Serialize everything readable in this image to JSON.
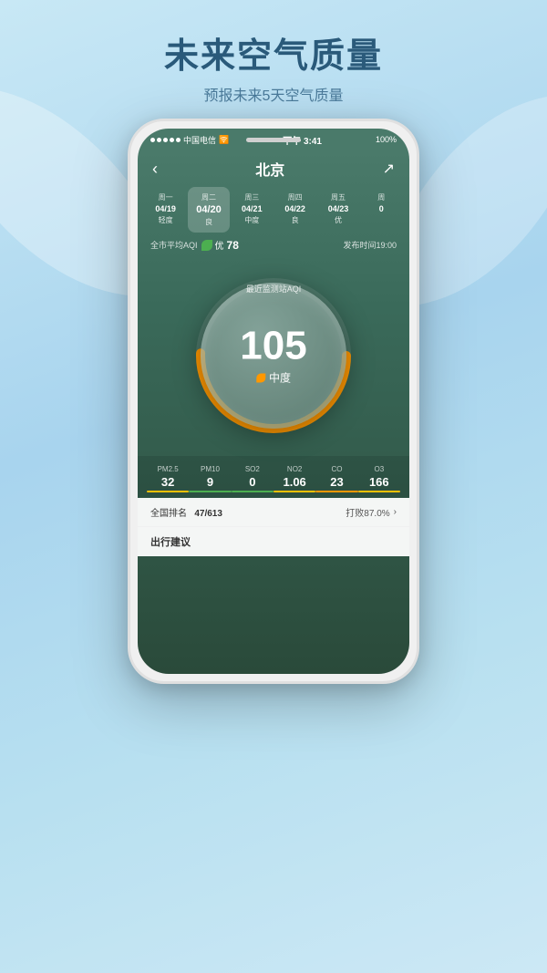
{
  "page": {
    "background": "light-blue-gradient"
  },
  "header": {
    "main_title": "未来空气质量",
    "sub_title": "预报未来5天空气质量"
  },
  "phone": {
    "status_bar": {
      "carrier": "中国电信",
      "wifi": true,
      "time": "下午 3:41",
      "battery": "100%"
    },
    "nav": {
      "back_label": "‹",
      "city": "北京",
      "share_label": "⬡"
    },
    "day_tabs": [
      {
        "weekday": "周一",
        "date": "04/19",
        "quality": "轻度",
        "active": false
      },
      {
        "weekday": "周二",
        "date": "04/20",
        "quality": "良",
        "active": true
      },
      {
        "weekday": "周三",
        "date": "04/21",
        "quality": "中度",
        "active": false
      },
      {
        "weekday": "周四",
        "date": "04/22",
        "quality": "良",
        "active": false
      },
      {
        "weekday": "周五",
        "date": "04/23",
        "quality": "优",
        "active": false
      },
      {
        "weekday": "周",
        "date": "0",
        "quality": "",
        "active": false
      }
    ],
    "aqi_info": {
      "label": "全市平均AQI",
      "value": "78",
      "quality": "优",
      "publish_time": "发布时间19:00"
    },
    "gauge": {
      "label": "最近监测站AQI",
      "value": "105",
      "quality": "中度"
    },
    "pollutants": [
      {
        "name": "PM2.5",
        "value": "32",
        "bar_color": "yellow"
      },
      {
        "name": "PM10",
        "value": "9",
        "bar_color": "green"
      },
      {
        "name": "SO2",
        "value": "0",
        "bar_color": "green"
      },
      {
        "name": "NO2",
        "value": "1.06",
        "bar_color": "yellow"
      },
      {
        "name": "CO",
        "value": "23",
        "bar_color": "orange"
      },
      {
        "name": "O3",
        "value": "166",
        "bar_color": "yellow"
      }
    ],
    "ranking": {
      "label": "全国排名",
      "rank": "47/613",
      "beat_label": "打败87.0%",
      "arrow": ">"
    },
    "travel": {
      "label": "出行建议"
    }
  }
}
